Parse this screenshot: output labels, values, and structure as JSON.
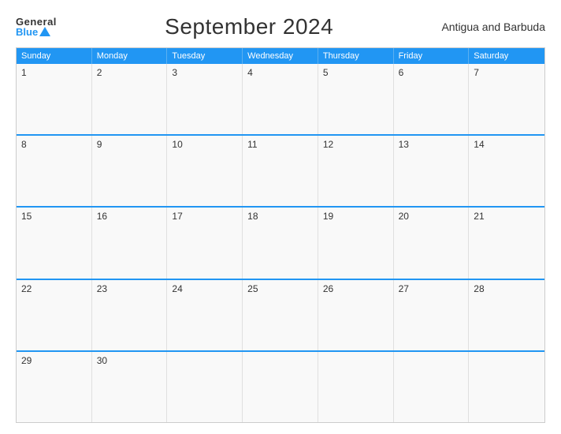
{
  "header": {
    "logo_general": "General",
    "logo_blue": "Blue",
    "title": "September 2024",
    "country": "Antigua and Barbuda"
  },
  "days_of_week": [
    "Sunday",
    "Monday",
    "Tuesday",
    "Wednesday",
    "Thursday",
    "Friday",
    "Saturday"
  ],
  "weeks": [
    [
      {
        "num": "1",
        "empty": false
      },
      {
        "num": "2",
        "empty": false
      },
      {
        "num": "3",
        "empty": false
      },
      {
        "num": "4",
        "empty": false
      },
      {
        "num": "5",
        "empty": false
      },
      {
        "num": "6",
        "empty": false
      },
      {
        "num": "7",
        "empty": false
      }
    ],
    [
      {
        "num": "8",
        "empty": false
      },
      {
        "num": "9",
        "empty": false
      },
      {
        "num": "10",
        "empty": false
      },
      {
        "num": "11",
        "empty": false
      },
      {
        "num": "12",
        "empty": false
      },
      {
        "num": "13",
        "empty": false
      },
      {
        "num": "14",
        "empty": false
      }
    ],
    [
      {
        "num": "15",
        "empty": false
      },
      {
        "num": "16",
        "empty": false
      },
      {
        "num": "17",
        "empty": false
      },
      {
        "num": "18",
        "empty": false
      },
      {
        "num": "19",
        "empty": false
      },
      {
        "num": "20",
        "empty": false
      },
      {
        "num": "21",
        "empty": false
      }
    ],
    [
      {
        "num": "22",
        "empty": false
      },
      {
        "num": "23",
        "empty": false
      },
      {
        "num": "24",
        "empty": false
      },
      {
        "num": "25",
        "empty": false
      },
      {
        "num": "26",
        "empty": false
      },
      {
        "num": "27",
        "empty": false
      },
      {
        "num": "28",
        "empty": false
      }
    ],
    [
      {
        "num": "29",
        "empty": false
      },
      {
        "num": "30",
        "empty": false
      },
      {
        "num": "",
        "empty": true
      },
      {
        "num": "",
        "empty": true
      },
      {
        "num": "",
        "empty": true
      },
      {
        "num": "",
        "empty": true
      },
      {
        "num": "",
        "empty": true
      }
    ]
  ]
}
